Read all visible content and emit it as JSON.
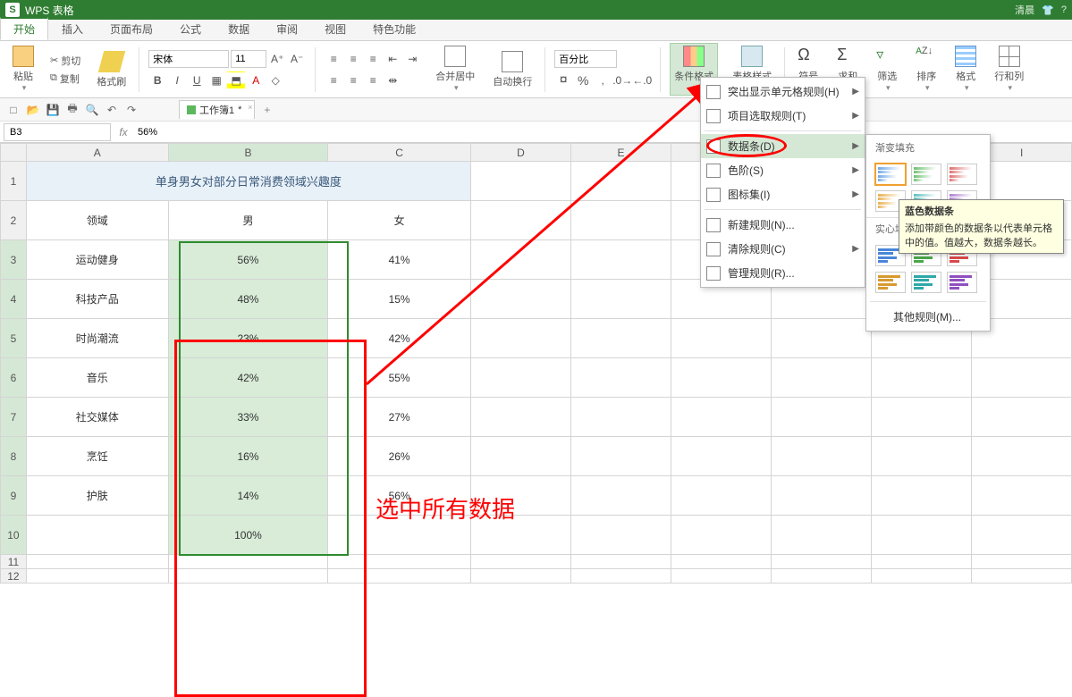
{
  "app": {
    "title": "WPS 表格",
    "user": "清晨"
  },
  "tabs": [
    "开始",
    "插入",
    "页面布局",
    "公式",
    "数据",
    "审阅",
    "视图",
    "特色功能"
  ],
  "active_tab": "开始",
  "ribbon": {
    "paste": "粘贴",
    "cut": "剪切",
    "copy": "复制",
    "format_painter": "格式刷",
    "font_name": "宋体",
    "font_size": "11",
    "merge_center": "合并居中",
    "wrap_text": "自动换行",
    "number_format": "百分比",
    "cond_format": "条件格式",
    "table_style": "表格样式",
    "symbol": "符号",
    "sum": "求和",
    "filter": "筛选",
    "sort": "排序",
    "format": "格式",
    "rowcol": "行和列"
  },
  "sheet_tab": {
    "name": "工作簿1",
    "dirty": "*"
  },
  "cell_ref": "B3",
  "formula_value": "56%",
  "columns": [
    "A",
    "B",
    "C",
    "D",
    "E",
    "F",
    "G",
    "H",
    "I"
  ],
  "row_heights_short": [
    11,
    12
  ],
  "data": {
    "title": "单身男女对部分日常消费领域兴趣度",
    "headers": {
      "a": "领域",
      "b": "男",
      "c": "女"
    },
    "rows": [
      {
        "a": "运动健身",
        "b": "56%",
        "c": "41%"
      },
      {
        "a": "科技产品",
        "b": "48%",
        "c": "15%"
      },
      {
        "a": "时尚潮流",
        "b": "23%",
        "c": "42%"
      },
      {
        "a": "音乐",
        "b": "42%",
        "c": "55%"
      },
      {
        "a": "社交媒体",
        "b": "33%",
        "c": "27%"
      },
      {
        "a": "烹饪",
        "b": "16%",
        "c": "26%"
      },
      {
        "a": "护肤",
        "b": "14%",
        "c": "56%"
      },
      {
        "a": "",
        "b": "100%",
        "c": ""
      }
    ]
  },
  "callout": {
    "text": "选中所有数据"
  },
  "cond_menu": {
    "items": [
      {
        "label": "突出显示单元格规则(H)",
        "arrow": true
      },
      {
        "label": "项目选取规则(T)",
        "arrow": true
      },
      {
        "sep": true
      },
      {
        "label": "数据条(D)",
        "arrow": true,
        "hovered": true
      },
      {
        "label": "色阶(S)",
        "arrow": true
      },
      {
        "label": "图标集(I)",
        "arrow": true
      },
      {
        "sep": true
      },
      {
        "label": "新建规则(N)...",
        "arrow": false
      },
      {
        "label": "清除规则(C)",
        "arrow": true
      },
      {
        "label": "管理规则(R)...",
        "arrow": false
      }
    ]
  },
  "databar_submenu": {
    "section1": "渐变填充",
    "section2": "实心填充",
    "other": "其他规则(M)...",
    "tooltip_title": "蓝色数据条",
    "tooltip_body": "添加带颜色的数据条以代表单元格中的值。值越大，数据条越长。",
    "colors_gradient": [
      "#6fa8e6",
      "#70c070",
      "#e07070",
      "#e8b050",
      "#5fc0c0",
      "#b080d0"
    ],
    "colors_solid": [
      "#4a86d8",
      "#4aa84a",
      "#d84a4a",
      "#d89a30",
      "#30a8a8",
      "#9050c0"
    ]
  }
}
